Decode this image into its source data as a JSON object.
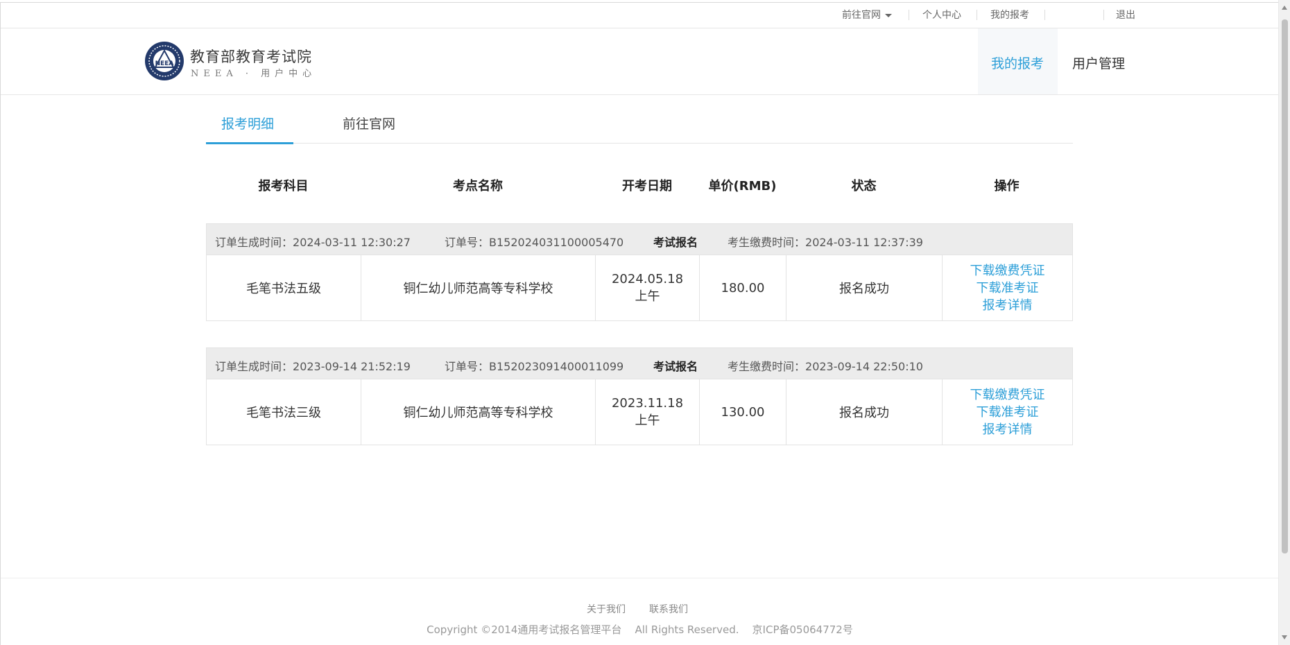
{
  "topbar": {
    "official_site": "前往官网",
    "personal_center": "个人中心",
    "my_registration": "我的报考",
    "logout": "退出"
  },
  "logo": {
    "title": "教育部教育考试院",
    "subtitle": "NEEA · 用户中心",
    "emblem_text": "NEEA"
  },
  "nav": {
    "my_registration": "我的报考",
    "user_management": "用户管理"
  },
  "tabs": [
    {
      "label": "报考明细"
    },
    {
      "label": "前往官网"
    }
  ],
  "table": {
    "headers": [
      "报考科目",
      "考点名称",
      "开考日期",
      "单价(RMB)",
      "状态",
      "操作"
    ],
    "orders": [
      {
        "created_label": "订单生成时间：",
        "created": "2024-03-11 12:30:27",
        "order_no_label": "订单号：",
        "order_no": "B152024031100005470",
        "type": "考试报名",
        "paid_label": "考生缴费时间：",
        "paid": "2024-03-11 12:37:39",
        "subject": "毛笔书法五级",
        "venue": "铜仁幼儿师范高等专科学校",
        "date": "2024.05.18 上午",
        "price": "180.00",
        "status": "报名成功",
        "actions": [
          "下载缴费凭证",
          "下载准考证",
          "报考详情"
        ]
      },
      {
        "created_label": "订单生成时间：",
        "created": "2023-09-14 21:52:19",
        "order_no_label": "订单号：",
        "order_no": "B152023091400011099",
        "type": "考试报名",
        "paid_label": "考生缴费时间：",
        "paid": "2023-09-14 22:50:10",
        "subject": "毛笔书法三级",
        "venue": "铜仁幼儿师范高等专科学校",
        "date": "2023.11.18 上午",
        "price": "130.00",
        "status": "报名成功",
        "actions": [
          "下载缴费凭证",
          "下载准考证",
          "报考详情"
        ]
      }
    ]
  },
  "footer": {
    "about": "关于我们",
    "contact": "联系我们",
    "copyright": "Copyright ©2014通用考试报名管理平台    All Rights Reserved.    京ICP备05064772号"
  },
  "colors": {
    "accent": "#2d9fd8",
    "order_header_bg": "#ececec"
  }
}
